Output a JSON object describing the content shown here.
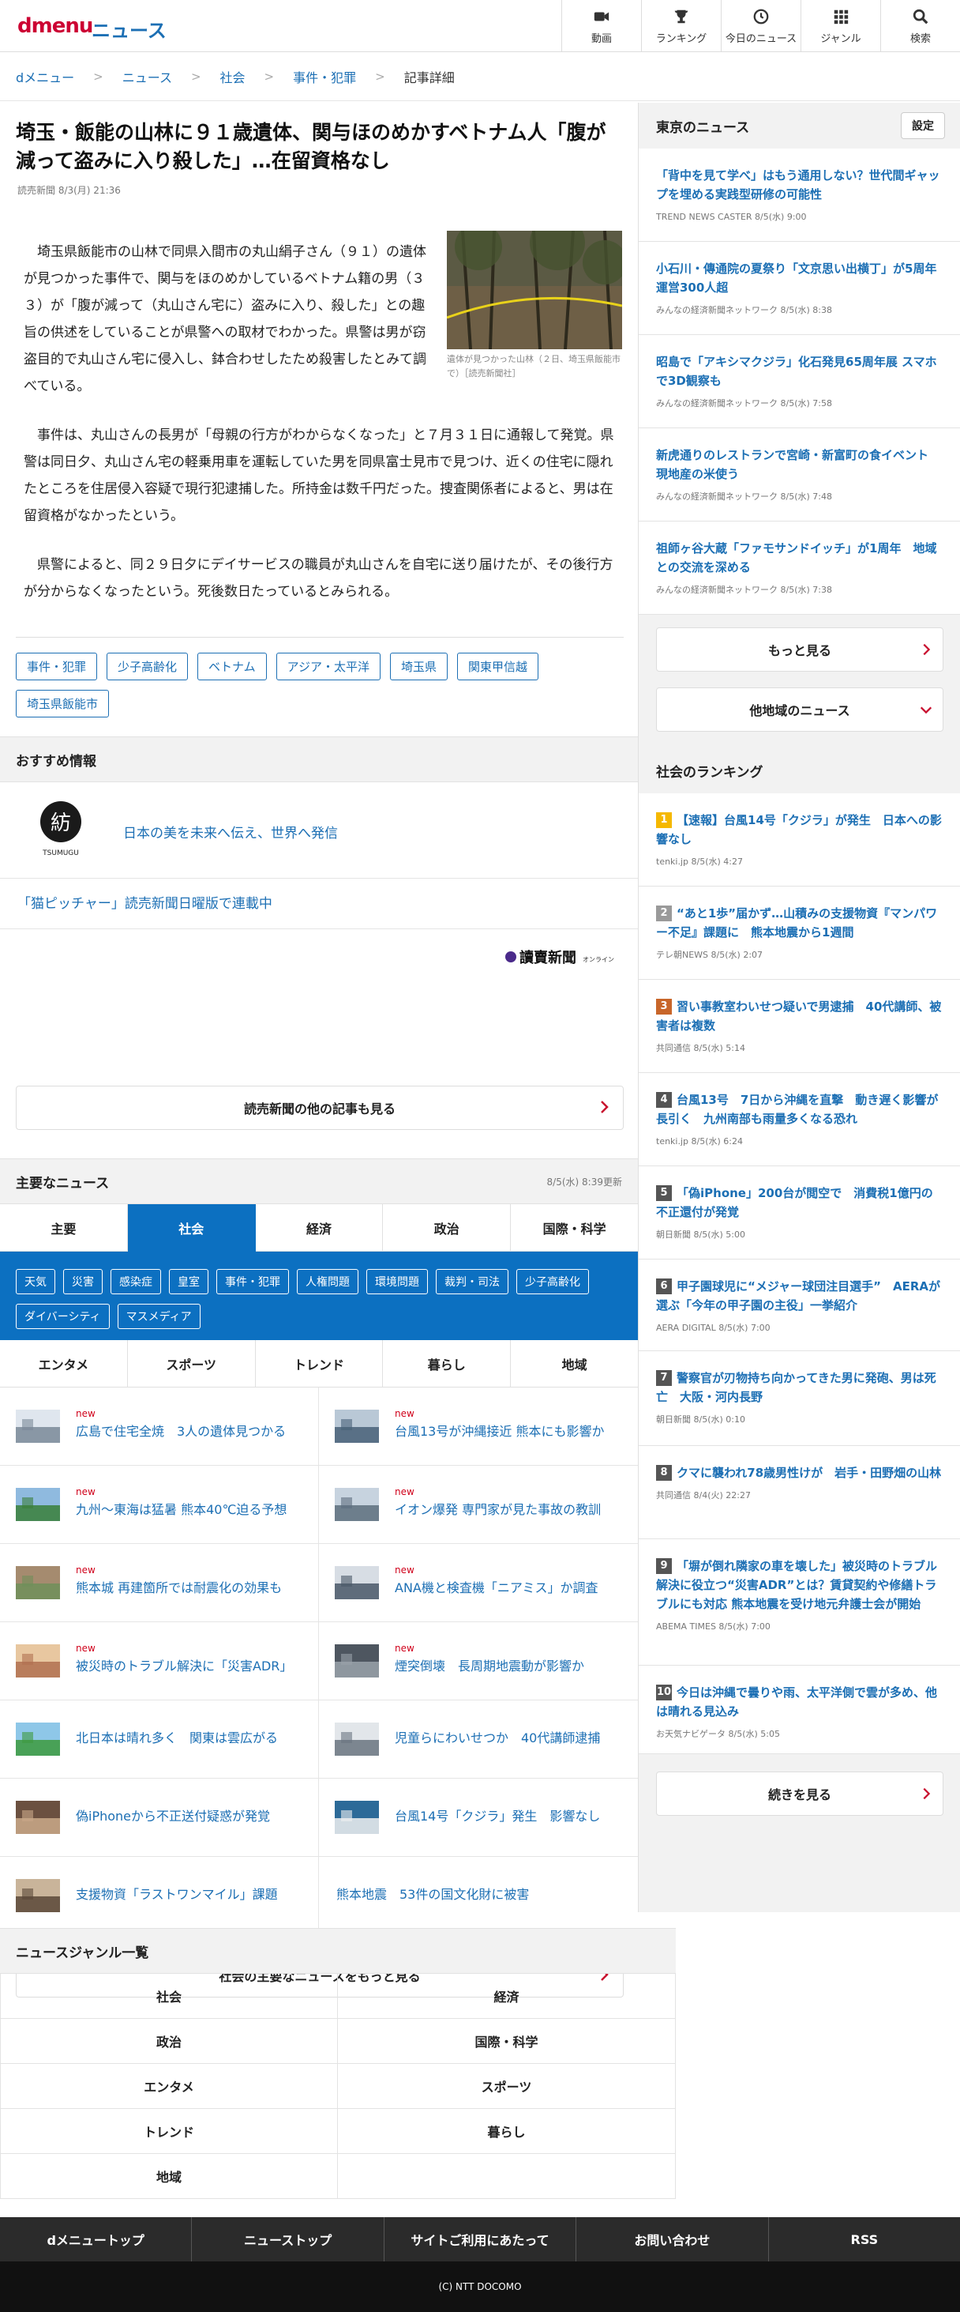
{
  "header": {
    "logo": "dmenu",
    "section": "ニュース",
    "nav": [
      {
        "label": "動画",
        "icon": "video-icon"
      },
      {
        "label": "ランキング",
        "icon": "trophy-icon"
      },
      {
        "label": "今日のニュース",
        "icon": "clock-icon"
      },
      {
        "label": "ジャンル",
        "icon": "grid-icon"
      },
      {
        "label": "検索",
        "icon": "search-icon"
      }
    ]
  },
  "breadcrumb": [
    "dメニュー",
    "ニュース",
    "社会",
    "事件・犯罪",
    "記事詳細"
  ],
  "article": {
    "title": "埼玉・飯能の山林に９１歳遺体、関与ほのめかすベトナム人「腹が減って盗みに入り殺した」…在留資格なし",
    "date": "読売新聞 8/3(月) 21:36",
    "paragraphs": [
      "埼玉県飯能市の山林で同県入間市の丸山絹子さん（９１）の遺体が見つかった事件で、関与をほのめかしているベトナム籍の男（３３）が「腹が減って（丸山さん宅に）盗みに入り、殺した」との趣旨の供述をしていることが県警への取材でわかった。県警は男が窃盗目的で丸山さん宅に侵入し、鉢合わせしたため殺害したとみて調べている。",
      "事件は、丸山さんの長男が「母親の行方がわからなくなった」と７月３１日に通報して発覚。県警は同日夕、丸山さん宅の軽乗用車を運転していた男を同県富士見市で見つけ、近くの住宅に隠れたところを住居侵入容疑で現行犯逮捕した。所持金は数千円だった。捜査関係者によると、男は在留資格がなかったという。",
      "県警によると、同２９日夕にデイサービスの職員が丸山さんを自宅に送り届けたが、その後行方が分からなくなったという。死後数日たっているとみられる。"
    ],
    "photo_caption": "遺体が見つかった山林（２日、埼玉県飯能市で）［読売新聞社］",
    "tags": [
      "事件・犯罪",
      "少子高齢化",
      "ベトナム",
      "アジア・太平洋",
      "埼玉県",
      "関東甲信越",
      "埼玉県飯能市"
    ]
  },
  "recommend": {
    "heading": "おすすめ情報",
    "item1_logo_caption": "TSUMUGU",
    "item1": "日本の美を未来へ伝え、世界へ発信",
    "item2": "「猫ピッチャー」読売新聞日曜版で連載中",
    "publisher_logo": "讀賣新聞オンライン",
    "more": "読売新聞の他の記事も見る"
  },
  "major": {
    "heading": "主要なニュース",
    "updated": "8/5(水) 8:39更新",
    "tabs": [
      "主要",
      "社会",
      "経済",
      "政治",
      "国際・科学"
    ],
    "active_tab": "社会",
    "subtags": [
      "天気",
      "災害",
      "感染症",
      "皇室",
      "事件・犯罪",
      "人権問題",
      "環境問題",
      "裁判・司法",
      "少子高齢化",
      "ダイバーシティ",
      "マスメディア"
    ],
    "tabs2": [
      "エンタメ",
      "スポーツ",
      "トレンド",
      "暮らし",
      "地域"
    ],
    "new_label": "new",
    "items": [
      {
        "title": "広島で住宅全焼　3人の遺体見つかる",
        "new": true
      },
      {
        "title": "台風13号が沖縄接近 熊本にも影響か",
        "new": true
      },
      {
        "title": "九州～東海は猛暑 熊本40℃迫る予想",
        "new": true
      },
      {
        "title": "イオン爆発 専門家が見た事故の教訓",
        "new": true
      },
      {
        "title": "熊本城 再建箇所では耐震化の効果も",
        "new": true
      },
      {
        "title": "ANA機と検査機「ニアミス」か調査",
        "new": true
      },
      {
        "title": "被災時のトラブル解決に「災害ADR」",
        "new": true
      },
      {
        "title": "煙突倒壊　長周期地震動が影響か",
        "new": true
      },
      {
        "title": "北日本は晴れ多く　関東は雲広がる",
        "new": false
      },
      {
        "title": "児童らにわいせつか　40代講師逮捕",
        "new": false
      },
      {
        "title": "偽iPhoneから不正送付疑惑が発覚",
        "new": false
      },
      {
        "title": "台風14号「クジラ」発生　影響なし",
        "new": false
      },
      {
        "title": "支援物資「ラストワンマイル」課題",
        "new": false
      },
      {
        "title": "熊本地震　53件の国文化財に被害",
        "new": false
      }
    ],
    "more": "社会の主要なニュースをもっと見る"
  },
  "tokyo": {
    "heading": "東京のニュース",
    "settings": "設定",
    "items": [
      {
        "title": "「背中を見て学べ」はもう通用しない？世代間ギャップを埋める実践型研修の可能性",
        "meta": "TREND NEWS CASTER 8/5(水) 9:00"
      },
      {
        "title": "小石川・傳通院の夏祭り「文京思い出横丁」が5周年　運営300人超",
        "meta": "みんなの経済新聞ネットワーク 8/5(水) 8:38"
      },
      {
        "title": "昭島で「アキシマクジラ」化石発見65周年展 スマホで3D観察も",
        "meta": "みんなの経済新聞ネットワーク 8/5(水) 7:58"
      },
      {
        "title": "新虎通りのレストランで宮崎・新富町の食イベント　現地産の米使う",
        "meta": "みんなの経済新聞ネットワーク 8/5(水) 7:48"
      },
      {
        "title": "祖師ヶ谷大蔵「ファモサンドイッチ」が1周年　地域との交流を深める",
        "meta": "みんなの経済新聞ネットワーク 8/5(水) 7:38"
      }
    ],
    "more": "もっと見る",
    "other": "他地域のニュース"
  },
  "ranking": {
    "heading": "社会のランキング",
    "items": [
      {
        "rank": "1",
        "title": "【速報】台風14号「クジラ」が発生　日本への影響なし",
        "meta": "tenki.jp 8/5(水) 4:27"
      },
      {
        "rank": "2",
        "title": "“あと1歩”届かず…山積みの支援物資『マンパワー不足』課題に　熊本地震から1週間",
        "meta": "テレ朝NEWS 8/5(水) 2:07"
      },
      {
        "rank": "3",
        "title": "習い事教室わいせつ疑いで男逮捕　40代講師、被害者は複数",
        "meta": "共同通信 8/5(水) 5:14"
      },
      {
        "rank": "4",
        "title": "台風13号　7日から沖縄を直撃　動き遅く影響が長引く　九州南部も雨量多くなる恐れ",
        "meta": "tenki.jp 8/5(水) 6:24"
      },
      {
        "rank": "5",
        "title": "「偽iPhone」200台が閲空で　消費税1億円の不正還付が発覚",
        "meta": "朝日新聞 8/5(水) 5:00"
      },
      {
        "rank": "6",
        "title": "甲子園球児に“メジャー球団注目選手”　AERAが選ぶ「今年の甲子園の主役」一挙紹介",
        "meta": "AERA DIGITAL 8/5(水) 7:00"
      },
      {
        "rank": "7",
        "title": "警察官が刃物持ち向かってきた男に発砲、男は死亡　大阪・河内長野",
        "meta": "朝日新聞 8/5(水) 0:10"
      },
      {
        "rank": "8",
        "title": "クマに襲われ78歳男性けが　岩手・田野畑の山林",
        "meta": "共同通信 8/4(火) 22:27"
      },
      {
        "rank": "9",
        "title": "「塀が倒れ隣家の車を壊した」被災時のトラブル解決に役立つ“災害ADR”とは？賃貸契約や修繕トラブルにも対応 熊本地震を受け地元弁護士会が開始",
        "meta": "ABEMA TIMES 8/5(水) 7:00"
      },
      {
        "rank": "10",
        "title": "今日は沖縄で曇りや雨、太平洋側で雲が多め、他は晴れる見込み",
        "meta": "お天気ナビゲータ 8/5(水) 5:05"
      }
    ],
    "more": "続きを見る"
  },
  "genres": {
    "heading": "ニュースジャンル一覧",
    "items": [
      "社会",
      "経済",
      "政治",
      "国際・科学",
      "エンタメ",
      "スポーツ",
      "トレンド",
      "暮らし",
      "地域",
      ""
    ]
  },
  "footer": {
    "links": [
      "dメニュートップ",
      "ニューストップ",
      "サイトご利用にあたって",
      "お問い合わせ",
      "RSS"
    ],
    "copyright": "(C) NTT DOCOMO"
  },
  "colors": {
    "accent": "#1c6fb4",
    "brand": "#cc0033",
    "tab_active": "#0c70c1",
    "new": "#d0021b",
    "rank1": "#f5b800",
    "rank2": "#9a9a9a",
    "rank3": "#c8662a",
    "rank_other": "#555555"
  }
}
